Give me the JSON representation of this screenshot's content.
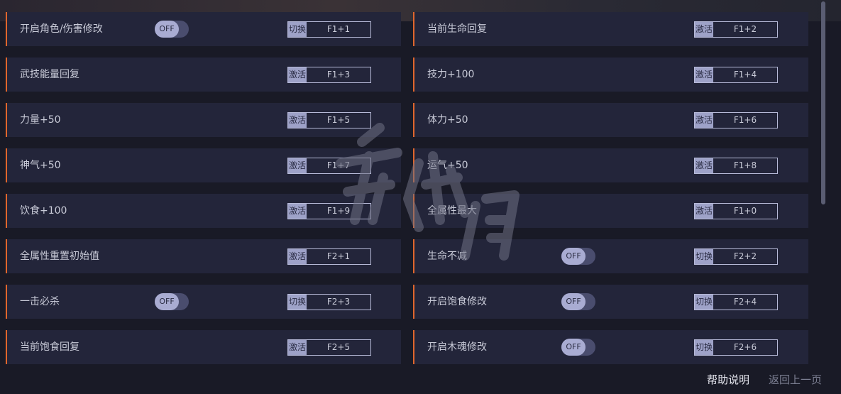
{
  "left_column": [
    {
      "label": "开启角色/伤害修改",
      "toggle": "OFF",
      "action": "切换",
      "key": "F1+1"
    },
    {
      "label": "武技能量回复",
      "toggle": null,
      "action": "激活",
      "key": "F1+3"
    },
    {
      "label": "力量+50",
      "toggle": null,
      "action": "激活",
      "key": "F1+5"
    },
    {
      "label": "神气+50",
      "toggle": null,
      "action": "激活",
      "key": "F1+7"
    },
    {
      "label": "饮食+100",
      "toggle": null,
      "action": "激活",
      "key": "F1+9"
    },
    {
      "label": "全属性重置初始值",
      "toggle": null,
      "action": "激活",
      "key": "F2+1"
    },
    {
      "label": "一击必杀",
      "toggle": "OFF",
      "action": "切换",
      "key": "F2+3"
    },
    {
      "label": "当前饱食回复",
      "toggle": null,
      "action": "激活",
      "key": "F2+5"
    }
  ],
  "right_column": [
    {
      "label": "当前生命回复",
      "toggle": null,
      "action": "激活",
      "key": "F1+2"
    },
    {
      "label": "技力+100",
      "toggle": null,
      "action": "激活",
      "key": "F1+4"
    },
    {
      "label": "体力+50",
      "toggle": null,
      "action": "激活",
      "key": "F1+6"
    },
    {
      "label": "运气+50",
      "toggle": null,
      "action": "激活",
      "key": "F1+8"
    },
    {
      "label": "全属性最大",
      "toggle": null,
      "action": "激活",
      "key": "F1+0"
    },
    {
      "label": "生命不减",
      "toggle": "OFF",
      "action": "切换",
      "key": "F2+2"
    },
    {
      "label": "开启饱食修改",
      "toggle": "OFF",
      "action": "切换",
      "key": "F2+4"
    },
    {
      "label": "开启木魂修改",
      "toggle": "OFF",
      "action": "切换",
      "key": "F2+6"
    }
  ],
  "footer": {
    "help": "帮助说明",
    "back": "返回上一页"
  },
  "colors": {
    "accent": "#e0662c",
    "row_bg": "#23253a",
    "toggle_knob": "#a9acd2",
    "key_tag": "#9ea2c8"
  }
}
